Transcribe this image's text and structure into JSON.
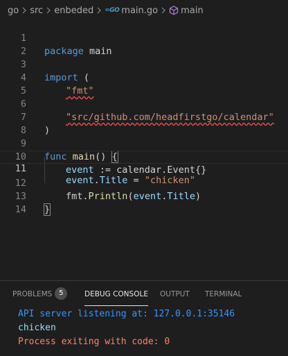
{
  "breadcrumb": {
    "items": [
      "go",
      "src",
      "enbeded",
      "main.go",
      "main"
    ],
    "file_icon": "go-file-icon",
    "symbol_icon": "cube-icon"
  },
  "editor": {
    "current_line": 11,
    "line_numbers": [
      "1",
      "2",
      "3",
      "4",
      "5",
      "6",
      "7",
      "8",
      "9",
      "10",
      "11",
      "12",
      "13",
      "14"
    ],
    "tokens": {
      "l1_kw": "package",
      "l1_name": " main",
      "l3_kw": "import",
      "l3_paren": " (",
      "l4_str": "\"fmt\"",
      "l6_str": "\"src/github.com/headfirstgo/calendar\"",
      "l7_paren": ")",
      "l9_kw": "func",
      "l9_fn": "main",
      "l9_rest": "() ",
      "l9_brace": "{",
      "l10_var": "event",
      "l10_op": " := calendar.",
      "l10_type": "Event",
      "l10_rest": "{}",
      "l11_var": "event",
      "l11_dot": ".",
      "l11_field": "Title",
      "l11_op": " = ",
      "l11_str": "\"chicken\"",
      "l12_pkg": "fmt",
      "l12_dot": ".",
      "l12_fn": "Println",
      "l12_open": "(",
      "l12_var": "event",
      "l12_dot2": ".",
      "l12_field": "Title",
      "l12_close": ")",
      "l13_brace": "}"
    }
  },
  "panel": {
    "tabs": [
      {
        "label": "PROBLEMS",
        "badge": "5"
      },
      {
        "label": "DEBUG CONSOLE",
        "active": true
      },
      {
        "label": "OUTPUT"
      },
      {
        "label": "TERMINAL"
      }
    ],
    "console_lines": [
      {
        "text": "API server listening at: 127.0.0.1:35146",
        "color": "#3794ff"
      },
      {
        "text": "chicken",
        "color": "#9cdcfe"
      },
      {
        "text": "Process exiting with code: 0",
        "color": "#f48771"
      }
    ]
  },
  "colors": {
    "background": "#1e1e1e",
    "keyword": "#569cd6",
    "string": "#ce9178",
    "function": "#dcdcaa",
    "variable": "#9cdcfe",
    "error_squiggle": "#f14c4c"
  }
}
